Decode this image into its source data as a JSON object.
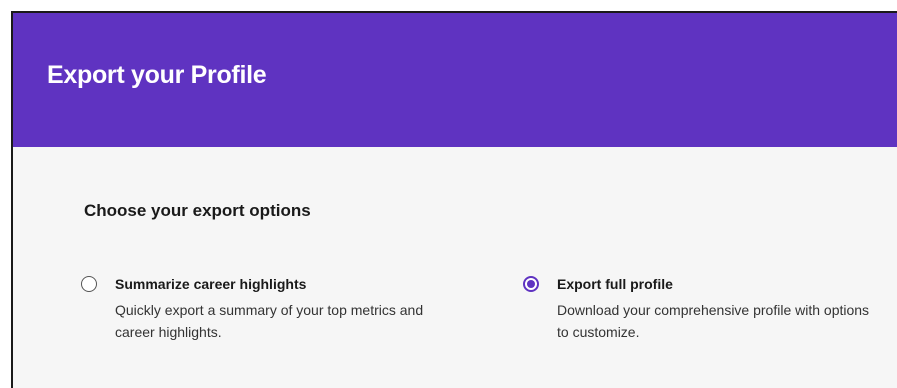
{
  "dialog": {
    "title": "Export your Profile",
    "section_title": "Choose your export options",
    "accent_color": "#5f33c1",
    "options": [
      {
        "label": "Summarize career highlights",
        "description": "Quickly export a summary of your top metrics and career highlights.",
        "selected": false
      },
      {
        "label": "Export full profile",
        "description": "Download your comprehensive profile with options to customize.",
        "selected": true
      }
    ]
  }
}
